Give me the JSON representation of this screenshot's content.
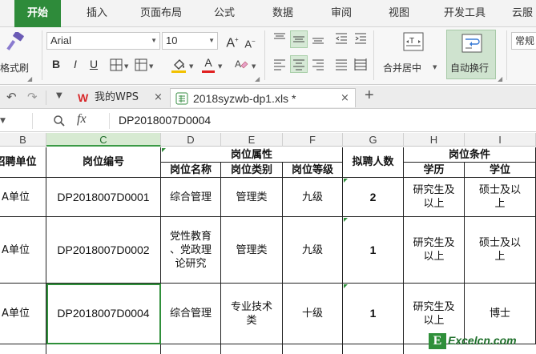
{
  "ribbon_tabs": [
    "开始",
    "插入",
    "页面布局",
    "公式",
    "数据",
    "审阅",
    "视图",
    "开发工具",
    "云服"
  ],
  "ribbon": {
    "format_painter_label": "格式刷",
    "font_name": "Arial",
    "font_size": "10",
    "bold": "B",
    "italic": "I",
    "underline": "U",
    "grow_font": "A",
    "shrink_font": "A",
    "font_color_glyph": "A",
    "merge_center_label": "合并居中",
    "wrap_text_label": "自动换行",
    "number_format": "常规"
  },
  "quick_access": {
    "wps_tab_label": "我的WPS",
    "doc_tab_label": "2018syzwb-dp1.xls *",
    "add_tab": "+"
  },
  "formula_bar": {
    "fx": "fx",
    "value": "DP2018007D0004"
  },
  "columns": [
    "B",
    "C",
    "D",
    "E",
    "F",
    "G",
    "H",
    "I"
  ],
  "selected_column": "C",
  "table": {
    "header": {
      "recruit_unit": "招聘单位",
      "position_code": "岗位编号",
      "position_attr": "岗位属性",
      "position_name": "岗位名称",
      "position_type": "岗位类别",
      "position_level": "岗位等级",
      "planned_count": "拟聘人数",
      "conditions": "岗位条件",
      "education": "学历",
      "degree": "学位"
    },
    "rows": [
      {
        "unit": "A单位",
        "code": "DP2018007D0001",
        "name": "综合管理",
        "type": "管理类",
        "level": "九级",
        "count": "2",
        "education": "研究生及\n以上",
        "degree": "硕士及以\n上"
      },
      {
        "unit": "A单位",
        "code": "DP2018007D0002",
        "name": "党性教育\n、党政理\n论研究",
        "type": "管理类",
        "level": "九级",
        "count": "1",
        "education": "研究生及\n以上",
        "degree": "硕士及以\n上"
      },
      {
        "unit": "A单位",
        "code": "DP2018007D0004",
        "name": "综合管理",
        "type": "专业技术\n类",
        "level": "十级",
        "count": "1",
        "education": "研究生及\n以上",
        "degree": "博士"
      }
    ]
  },
  "watermark": {
    "letter": "E",
    "text": "Excelcn.com"
  },
  "colors": {
    "accent": "#2e8b3a",
    "selection": "#2f8f3a"
  }
}
